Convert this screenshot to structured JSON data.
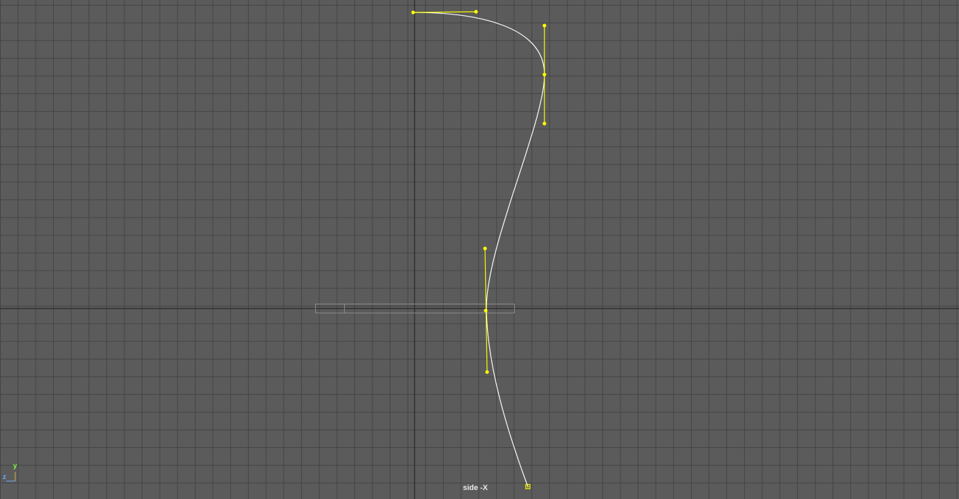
{
  "viewport": {
    "camera_label": "side -X",
    "background_color": "#5b5b5b",
    "grid_color": "#444444",
    "axis_line_color": "#2f2f2f"
  },
  "axis_indicator": {
    "y_label": "y",
    "z_label": "z",
    "y_color": "#7fff3f",
    "z_color": "#6ea8ff"
  },
  "curve": {
    "color": "#ffffff",
    "handle_color": "#ffff00",
    "cv_count": 4,
    "selected": true
  },
  "ground_box": {
    "color": "#8a8a8a"
  }
}
